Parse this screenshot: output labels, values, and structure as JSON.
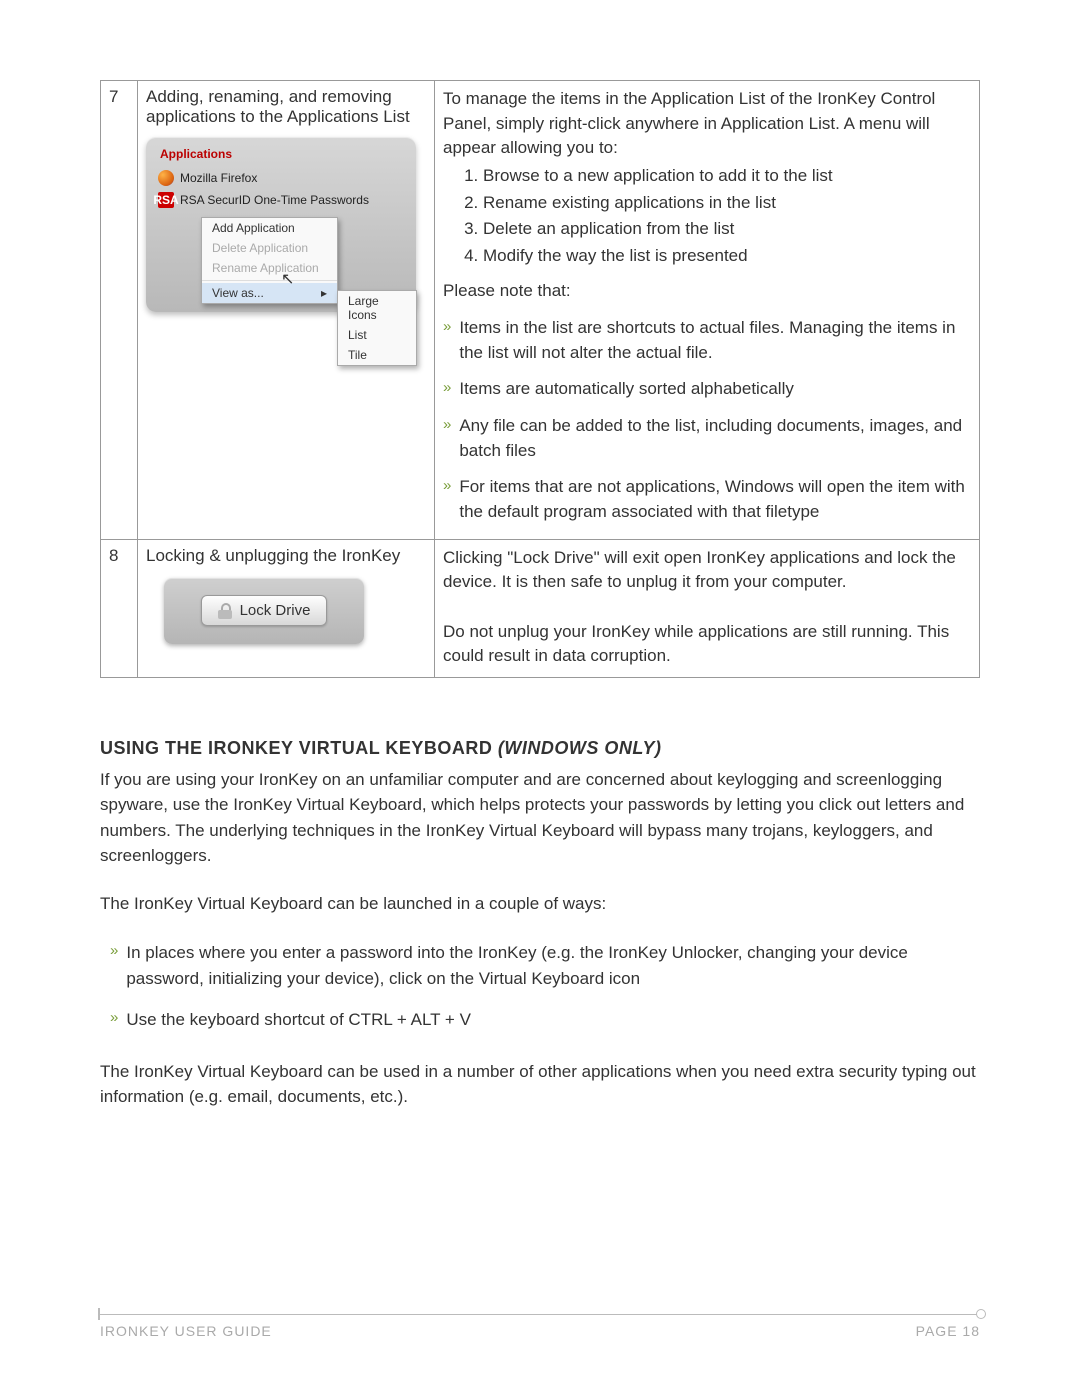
{
  "table": {
    "rows": [
      {
        "num": "7",
        "title": "Adding, renaming, and removing applications to the Applications List",
        "panel": {
          "heading": "Applications",
          "apps": [
            {
              "name": "Mozilla Firefox"
            },
            {
              "name": "RSA SecurID One-Time Passwords",
              "rsa_badge": "RSA"
            }
          ],
          "menu": {
            "add": "Add Application",
            "delete": "Delete Application",
            "rename": "Rename Application",
            "viewas": "View as...",
            "submenu": [
              "Large Icons",
              "List",
              "Tile"
            ]
          }
        },
        "right": {
          "intro": "To manage the items in the Application List of the IronKey Control Panel, simply right-click anywhere in Application List. A menu will appear allowing you to:",
          "ol": [
            "Browse to a new application to add it to the list",
            "Rename existing applications in the list",
            "Delete an application from the list",
            "Modify the way the list is presented"
          ],
          "note_label": "Please note that:",
          "notes": [
            "Items in the list are shortcuts to actual files.  Managing the items in the list will not alter the actual file.",
            "Items are automatically sorted alphabetically",
            "Any file can be added to the list, including documents, images, and batch files",
            "For items that are not applications, Windows will open the item with the default program associated with that filetype"
          ]
        }
      },
      {
        "num": "8",
        "title": "Locking & unplugging the IronKey",
        "lock_button": "Lock Drive",
        "right_para1": "Clicking \"Lock Drive\" will exit open IronKey applications and lock the device.  It is then safe to unplug it from your computer.",
        "right_para2": "Do not unplug your IronKey while applications are still running.  This could result in data corruption."
      }
    ]
  },
  "section": {
    "heading_bold": "USING THE IRONKEY VIRTUAL KEYBOARD ",
    "heading_italic": "(WINDOWS ONLY)",
    "p1": "If you are using your IronKey on an unfamiliar computer and are concerned about keylogging and screenlogging spyware, use the IronKey Virtual Keyboard, which helps protects your passwords by letting you click out letters and numbers.  The underlying techniques in the IronKey Virtual Keyboard will bypass many trojans, keyloggers, and screenloggers.",
    "p2": "The IronKey Virtual Keyboard can be launched in a couple of ways:",
    "bullets": [
      "In places where you enter a password into the IronKey (e.g. the IronKey Unlocker, changing your device password, initializing your device), click on the Virtual Keyboard icon",
      "Use the keyboard shortcut of  CTRL + ALT + V"
    ],
    "p3": "The IronKey Virtual Keyboard can be used in a number of other applications when you need extra security typing out information (e.g. email, documents, etc.)."
  },
  "footer": {
    "left": "IRONKEY USER GUIDE",
    "right": "PAGE  18"
  }
}
